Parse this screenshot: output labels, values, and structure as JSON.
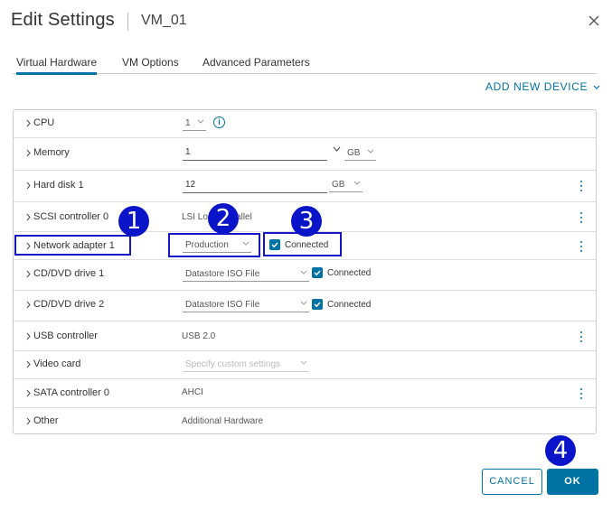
{
  "header": {
    "title": "Edit Settings",
    "vm_name": "VM_01",
    "close_icon": "close-icon"
  },
  "tabs": [
    {
      "label": "Virtual Hardware",
      "active": true
    },
    {
      "label": "VM Options",
      "active": false
    },
    {
      "label": "Advanced Parameters",
      "active": false
    }
  ],
  "add_device_label": "ADD NEW DEVICE",
  "rows": {
    "cpu": {
      "label": "CPU",
      "value": "1"
    },
    "memory": {
      "label": "Memory",
      "value": "1",
      "unit": "GB"
    },
    "hard_disk": {
      "label": "Hard disk 1",
      "value": "12",
      "unit": "GB"
    },
    "scsi": {
      "label": "SCSI controller 0",
      "value": "LSI Logic Parallel"
    },
    "network": {
      "label": "Network adapter 1",
      "network": "Production",
      "connected_label": "Connected",
      "connected": true
    },
    "cd1": {
      "label": "CD/DVD drive 1",
      "value": "Datastore ISO File",
      "connected_label": "Connected",
      "connected": true
    },
    "cd2": {
      "label": "CD/DVD drive 2",
      "value": "Datastore ISO File",
      "connected_label": "Connected",
      "connected": true
    },
    "usb": {
      "label": "USB controller",
      "value": "USB 2.0"
    },
    "video": {
      "label": "Video card",
      "placeholder": "Specify custom settings"
    },
    "sata": {
      "label": "SATA controller 0",
      "value": "AHCI"
    },
    "other": {
      "label": "Other",
      "value": "Additional Hardware"
    }
  },
  "callouts": [
    "1",
    "2",
    "3",
    "4"
  ],
  "buttons": {
    "cancel": "CANCEL",
    "ok": "OK"
  },
  "colors": {
    "accent": "#0072a3",
    "callout": "#0a14c8"
  }
}
